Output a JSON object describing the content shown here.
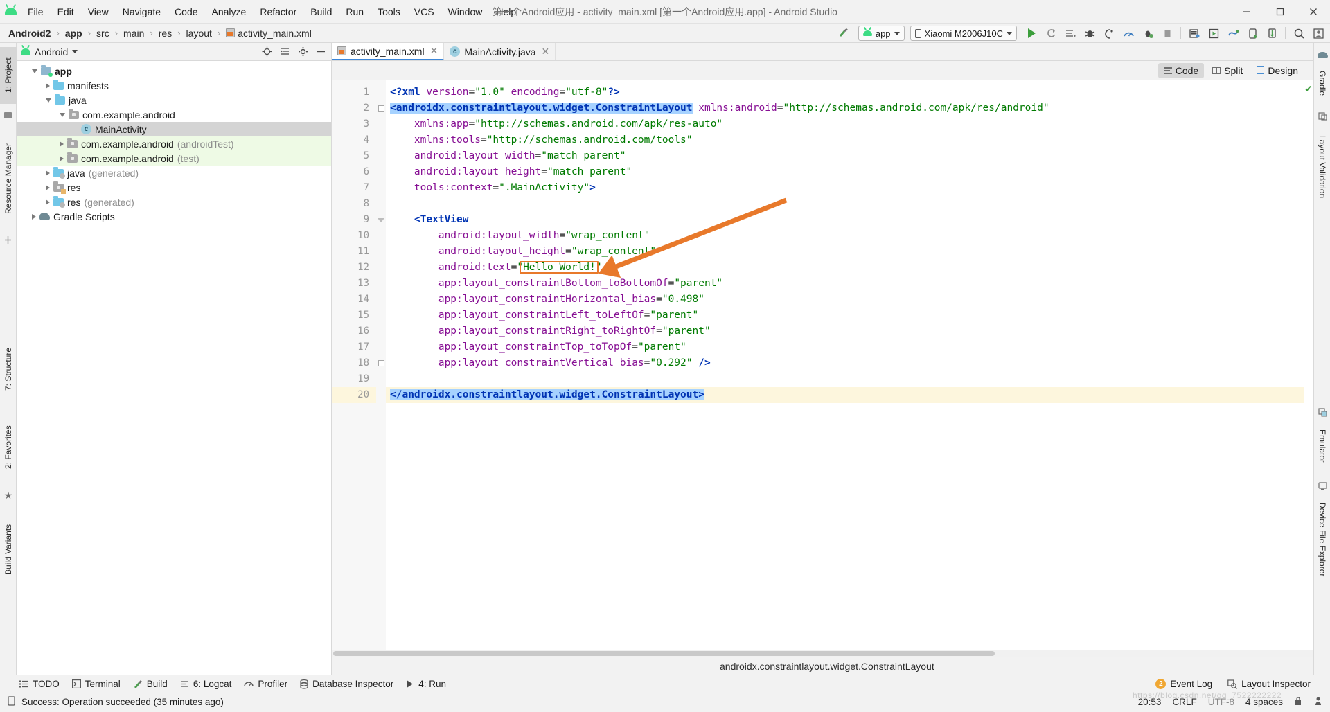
{
  "window": {
    "title": "第一个Android应用 - activity_main.xml [第一个Android应用.app] - Android Studio",
    "minimize": "–",
    "maximize": "▢",
    "close": "✕"
  },
  "menu": {
    "logo_icon": "android-logo-icon",
    "items": [
      "File",
      "Edit",
      "View",
      "Navigate",
      "Code",
      "Analyze",
      "Refactor",
      "Build",
      "Run",
      "Tools",
      "VCS",
      "Window",
      "Help"
    ]
  },
  "breadcrumb": {
    "items": [
      "Android2",
      "app",
      "src",
      "main",
      "res",
      "layout",
      "activity_main.xml"
    ],
    "separator": "›",
    "file_icon": "xml-file-icon"
  },
  "toolbar": {
    "build_icon": "hammer-icon",
    "run_config": {
      "label": "app",
      "icon": "android-head-icon"
    },
    "device": {
      "label": "Xiaomi M2006J10C",
      "icon": "phone-icon"
    },
    "actions": [
      {
        "name": "run-icon",
        "glyph": "▶"
      },
      {
        "name": "apply-changes-icon",
        "glyph": "⟳"
      },
      {
        "name": "apply-code-changes-icon",
        "glyph": "≣"
      },
      {
        "name": "debug-icon",
        "glyph": "🐞"
      },
      {
        "name": "attach-debugger-icon",
        "glyph": "◖"
      },
      {
        "name": "profile-icon",
        "glyph": "◠"
      },
      {
        "name": "run-with-coverage-icon",
        "glyph": "⚘"
      },
      {
        "name": "stop-icon",
        "glyph": "■"
      },
      {
        "name": "sdk-manager-icon",
        "glyph": "▤"
      },
      {
        "name": "avd-manager-icon",
        "glyph": "▣"
      },
      {
        "name": "sync-gradle-icon",
        "glyph": "⟿"
      },
      {
        "name": "device-manager-icon",
        "glyph": "▯"
      },
      {
        "name": "layout-inspector-icon",
        "glyph": "⬍"
      },
      {
        "name": "search-everywhere-icon",
        "glyph": "🔍"
      },
      {
        "name": "profile-user-icon",
        "glyph": "👤"
      }
    ]
  },
  "left_strip": {
    "project_tab": "1: Project",
    "resource_manager_tab": "Resource Manager",
    "structure_tab": "7: Structure",
    "favorites_tab": "2: Favorites",
    "build_variants_tab": "Build Variants"
  },
  "project_panel": {
    "header": {
      "title": "Android",
      "icon": "android-head-icon",
      "caret": "▾"
    },
    "header_actions": [
      {
        "name": "locate-icon",
        "glyph": "⊕"
      },
      {
        "name": "collapse-all-icon",
        "glyph": "⇥"
      },
      {
        "name": "settings-gear-icon",
        "glyph": "⚙"
      },
      {
        "name": "hide-panel-icon",
        "glyph": "—"
      }
    ],
    "tree": [
      {
        "label": "app",
        "suffix": "",
        "indent": 0,
        "expander": "down",
        "icon": "module-folder",
        "bold": true,
        "state": "normal"
      },
      {
        "label": "manifests",
        "suffix": "",
        "indent": 1,
        "expander": "right",
        "icon": "folder-blue",
        "bold": false,
        "state": "normal"
      },
      {
        "label": "java",
        "suffix": "",
        "indent": 1,
        "expander": "down",
        "icon": "folder-blue",
        "bold": false,
        "state": "normal"
      },
      {
        "label": "com.example.android",
        "suffix": "",
        "indent": 2,
        "expander": "down",
        "icon": "package",
        "bold": false,
        "state": "normal"
      },
      {
        "label": "MainActivity",
        "suffix": "",
        "indent": 3,
        "expander": "none",
        "icon": "class",
        "bold": false,
        "state": "selected"
      },
      {
        "label": "com.example.android",
        "suffix": " (androidTest)",
        "indent": 2,
        "expander": "right",
        "icon": "package",
        "bold": false,
        "state": "green"
      },
      {
        "label": "com.example.android",
        "suffix": " (test)",
        "indent": 2,
        "expander": "right",
        "icon": "package",
        "bold": false,
        "state": "green"
      },
      {
        "label": "java",
        "suffix": " (generated)",
        "indent": 1,
        "expander": "right",
        "icon": "folder-generated",
        "bold": false,
        "state": "normal"
      },
      {
        "label": "res",
        "suffix": "",
        "indent": 1,
        "expander": "right",
        "icon": "folder-res",
        "bold": false,
        "state": "normal"
      },
      {
        "label": "res",
        "suffix": " (generated)",
        "indent": 1,
        "expander": "right",
        "icon": "folder-generated",
        "bold": false,
        "state": "normal"
      },
      {
        "label": "Gradle Scripts",
        "suffix": "",
        "indent": 0,
        "expander": "right",
        "icon": "gradle",
        "bold": false,
        "state": "normal"
      }
    ]
  },
  "editor": {
    "tabs": [
      {
        "label": "activity_main.xml",
        "icon": "xml-file-icon",
        "active": true,
        "close": "✕"
      },
      {
        "label": "MainActivity.java",
        "icon": "class-icon",
        "active": false,
        "close": "✕"
      }
    ],
    "view_modes": [
      {
        "label": "Code",
        "icon": "code-lines-icon",
        "active": true
      },
      {
        "label": "Split",
        "icon": "split-view-icon",
        "active": false
      },
      {
        "label": "Design",
        "icon": "design-view-icon",
        "active": false
      }
    ],
    "inspection_status_icon": "green-check-icon",
    "bottom_breadcrumb": "androidx.constraintlayout.widget.ConstraintLayout",
    "lines": [
      {
        "n": 1,
        "highlight": false,
        "marker": "",
        "fold": "",
        "tokens": [
          {
            "t": "<?xml ",
            "c": "pi"
          },
          {
            "t": "version",
            "c": "attr"
          },
          {
            "t": "=",
            "c": "punct"
          },
          {
            "t": "\"1.0\"",
            "c": "val"
          },
          {
            "t": " ",
            "c": "punct"
          },
          {
            "t": "encoding",
            "c": "attr"
          },
          {
            "t": "=",
            "c": "punct"
          },
          {
            "t": "\"utf-8\"",
            "c": "val"
          },
          {
            "t": "?>",
            "c": "pi"
          }
        ]
      },
      {
        "n": 2,
        "highlight": false,
        "marker": "C",
        "fold": "box",
        "tokens": [
          {
            "t": "<androidx.constraintlayout.widget.ConstraintLayout",
            "c": "tag sel-blue"
          },
          {
            "t": " ",
            "c": "punct"
          },
          {
            "t": "xmlns:android",
            "c": "attr"
          },
          {
            "t": "=",
            "c": "punct"
          },
          {
            "t": "\"http://schemas.android.com/apk/res/android\"",
            "c": "val"
          }
        ]
      },
      {
        "n": 3,
        "highlight": false,
        "marker": "",
        "fold": "",
        "tokens": [
          {
            "t": "    ",
            "c": "punct"
          },
          {
            "t": "xmlns:app",
            "c": "attr"
          },
          {
            "t": "=",
            "c": "punct"
          },
          {
            "t": "\"http://schemas.android.com/apk/res-auto\"",
            "c": "val"
          }
        ]
      },
      {
        "n": 4,
        "highlight": false,
        "marker": "",
        "fold": "",
        "tokens": [
          {
            "t": "    ",
            "c": "punct"
          },
          {
            "t": "xmlns:tools",
            "c": "attr"
          },
          {
            "t": "=",
            "c": "punct"
          },
          {
            "t": "\"http://schemas.android.com/tools\"",
            "c": "val"
          }
        ]
      },
      {
        "n": 5,
        "highlight": false,
        "marker": "",
        "fold": "",
        "tokens": [
          {
            "t": "    ",
            "c": "punct"
          },
          {
            "t": "android:layout_width",
            "c": "attr"
          },
          {
            "t": "=",
            "c": "punct"
          },
          {
            "t": "\"match_parent\"",
            "c": "val"
          }
        ]
      },
      {
        "n": 6,
        "highlight": false,
        "marker": "",
        "fold": "",
        "tokens": [
          {
            "t": "    ",
            "c": "punct"
          },
          {
            "t": "android:layout_height",
            "c": "attr"
          },
          {
            "t": "=",
            "c": "punct"
          },
          {
            "t": "\"match_parent\"",
            "c": "val"
          }
        ]
      },
      {
        "n": 7,
        "highlight": false,
        "marker": "",
        "fold": "",
        "tokens": [
          {
            "t": "    ",
            "c": "punct"
          },
          {
            "t": "tools:context",
            "c": "attr"
          },
          {
            "t": "=",
            "c": "punct"
          },
          {
            "t": "\".MainActivity\"",
            "c": "val"
          },
          {
            "t": ">",
            "c": "tag"
          }
        ]
      },
      {
        "n": 8,
        "highlight": false,
        "marker": "",
        "fold": "",
        "tokens": []
      },
      {
        "n": 9,
        "highlight": false,
        "marker": "",
        "fold": "tri",
        "tokens": [
          {
            "t": "    ",
            "c": "punct"
          },
          {
            "t": "<TextView",
            "c": "tag"
          }
        ]
      },
      {
        "n": 10,
        "highlight": false,
        "marker": "",
        "fold": "",
        "tokens": [
          {
            "t": "        ",
            "c": "punct"
          },
          {
            "t": "android:layout_width",
            "c": "attr"
          },
          {
            "t": "=",
            "c": "punct"
          },
          {
            "t": "\"wrap_content\"",
            "c": "val"
          }
        ]
      },
      {
        "n": 11,
        "highlight": false,
        "marker": "",
        "fold": "",
        "tokens": [
          {
            "t": "        ",
            "c": "punct"
          },
          {
            "t": "android:layout_height",
            "c": "attr"
          },
          {
            "t": "=",
            "c": "punct"
          },
          {
            "t": "\"wrap_content\"",
            "c": "val"
          }
        ]
      },
      {
        "n": 12,
        "highlight": false,
        "marker": "",
        "fold": "",
        "tokens": [
          {
            "t": "        ",
            "c": "punct"
          },
          {
            "t": "android:text",
            "c": "attr"
          },
          {
            "t": "=",
            "c": "punct"
          },
          {
            "t": "\"Hello World!\"",
            "c": "val"
          }
        ]
      },
      {
        "n": 13,
        "highlight": false,
        "marker": "",
        "fold": "",
        "tokens": [
          {
            "t": "        ",
            "c": "punct"
          },
          {
            "t": "app:layout_constraintBottom_toBottomOf",
            "c": "attr"
          },
          {
            "t": "=",
            "c": "punct"
          },
          {
            "t": "\"parent\"",
            "c": "val"
          }
        ]
      },
      {
        "n": 14,
        "highlight": false,
        "marker": "",
        "fold": "",
        "tokens": [
          {
            "t": "        ",
            "c": "punct"
          },
          {
            "t": "app:layout_constraintHorizontal_bias",
            "c": "attr"
          },
          {
            "t": "=",
            "c": "punct"
          },
          {
            "t": "\"0.498\"",
            "c": "val"
          }
        ]
      },
      {
        "n": 15,
        "highlight": false,
        "marker": "",
        "fold": "",
        "tokens": [
          {
            "t": "        ",
            "c": "punct"
          },
          {
            "t": "app:layout_constraintLeft_toLeftOf",
            "c": "attr"
          },
          {
            "t": "=",
            "c": "punct"
          },
          {
            "t": "\"parent\"",
            "c": "val"
          }
        ]
      },
      {
        "n": 16,
        "highlight": false,
        "marker": "",
        "fold": "",
        "tokens": [
          {
            "t": "        ",
            "c": "punct"
          },
          {
            "t": "app:layout_constraintRight_toRightOf",
            "c": "attr"
          },
          {
            "t": "=",
            "c": "punct"
          },
          {
            "t": "\"parent\"",
            "c": "val"
          }
        ]
      },
      {
        "n": 17,
        "highlight": false,
        "marker": "",
        "fold": "",
        "tokens": [
          {
            "t": "        ",
            "c": "punct"
          },
          {
            "t": "app:layout_constraintTop_toTopOf",
            "c": "attr"
          },
          {
            "t": "=",
            "c": "punct"
          },
          {
            "t": "\"parent\"",
            "c": "val"
          }
        ]
      },
      {
        "n": 18,
        "highlight": false,
        "marker": "",
        "fold": "box",
        "tokens": [
          {
            "t": "        ",
            "c": "punct"
          },
          {
            "t": "app:layout_constraintVertical_bias",
            "c": "attr"
          },
          {
            "t": "=",
            "c": "punct"
          },
          {
            "t": "\"0.292\"",
            "c": "val"
          },
          {
            "t": " ",
            "c": "punct"
          },
          {
            "t": "/>",
            "c": "tag"
          }
        ]
      },
      {
        "n": 19,
        "highlight": false,
        "marker": "bulb",
        "fold": "",
        "tokens": []
      },
      {
        "n": 20,
        "highlight": true,
        "marker": "",
        "fold": "",
        "tokens": [
          {
            "t": "</androidx.constraintlayout.widget.ConstraintLayout>",
            "c": "tag sel-blue"
          }
        ]
      }
    ]
  },
  "annotation": {
    "highlight_text": "Hello World!",
    "box_color": "#e8792b",
    "arrow_color": "#e8792b"
  },
  "right_strip": {
    "tabs": [
      "Gradle",
      "Layout Validation",
      "Emulator",
      "Device File Explorer"
    ]
  },
  "bottom_tools": {
    "items": [
      {
        "label": "TODO",
        "icon": "todo-icon",
        "mnemonic": ""
      },
      {
        "label": "Terminal",
        "icon": "terminal-icon",
        "mnemonic": ""
      },
      {
        "label": "Build",
        "icon": "hammer-icon",
        "mnemonic": ""
      },
      {
        "label": "6: Logcat",
        "icon": "logcat-icon",
        "mnemonic": "6"
      },
      {
        "label": "Profiler",
        "icon": "profiler-icon",
        "mnemonic": ""
      },
      {
        "label": "Database Inspector",
        "icon": "database-icon",
        "mnemonic": ""
      },
      {
        "label": "4: Run",
        "icon": "run-triangle-icon",
        "mnemonic": "4"
      }
    ],
    "right": [
      {
        "label": "Event Log",
        "icon": "event-log-icon",
        "badge": "2"
      },
      {
        "label": "Layout Inspector",
        "icon": "layout-inspector-icon",
        "badge": ""
      }
    ]
  },
  "statusbar": {
    "message": "Success: Operation succeeded (35 minutes ago)",
    "message_icon": "device-icon",
    "time": "20:53",
    "line_separator": "CRLF",
    "encoding": "UTF-8",
    "indent": "4 spaces",
    "lock_icon": "lock-icon",
    "inspection_icon": "inspector-icon",
    "watermark": "https://blog.csdn.net/qq_7522222222"
  }
}
